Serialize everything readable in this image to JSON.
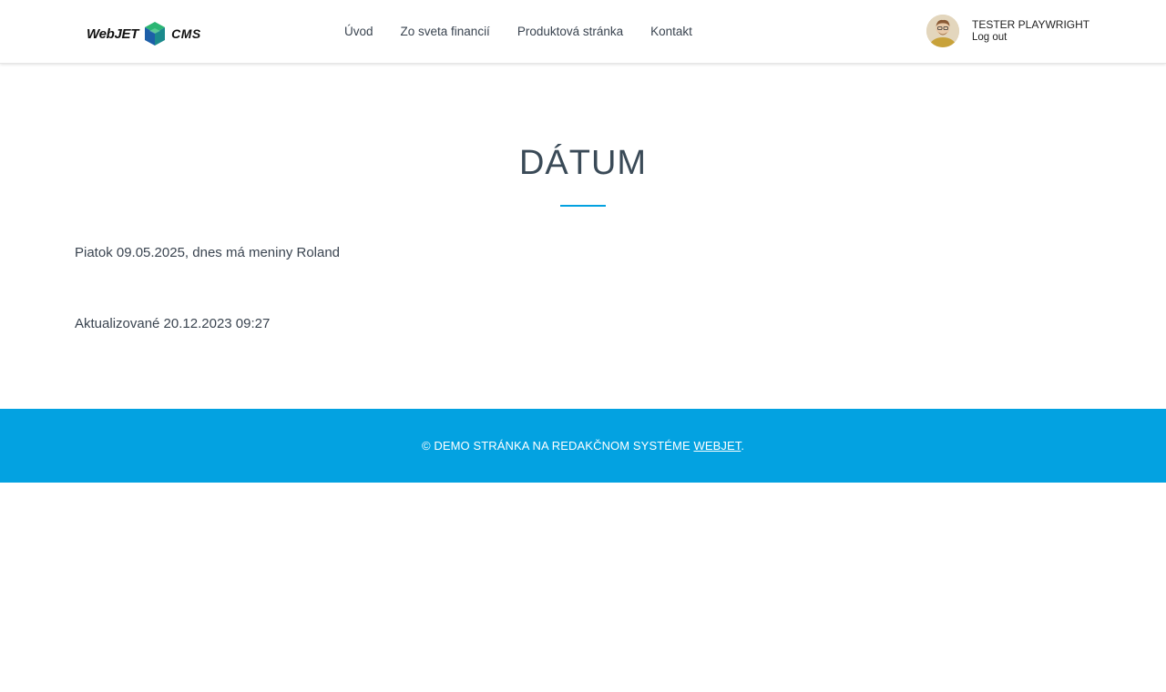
{
  "header": {
    "logo": {
      "left_text": "WebJET",
      "right_text": "CMS"
    },
    "nav": [
      {
        "label": "Úvod"
      },
      {
        "label": "Zo sveta financií"
      },
      {
        "label": "Produktová stránka"
      },
      {
        "label": "Kontakt"
      }
    ],
    "user": {
      "name": "TESTER PLAYWRIGHT",
      "logout_label": "Log out"
    }
  },
  "main": {
    "title": "DÁTUM",
    "date_text": "Piatok 09.05.2025, dnes má meniny Roland",
    "updated_text": "Aktualizované 20.12.2023 09:27"
  },
  "footer": {
    "text_before": "© DEMO STRÁNKA NA REDAKČNOM SYSTÉME ",
    "link_label": "WEBJET",
    "text_after": "."
  },
  "colors": {
    "accent": "#03a2e1",
    "heading": "#3a4a57",
    "body_text": "#3a4450"
  }
}
